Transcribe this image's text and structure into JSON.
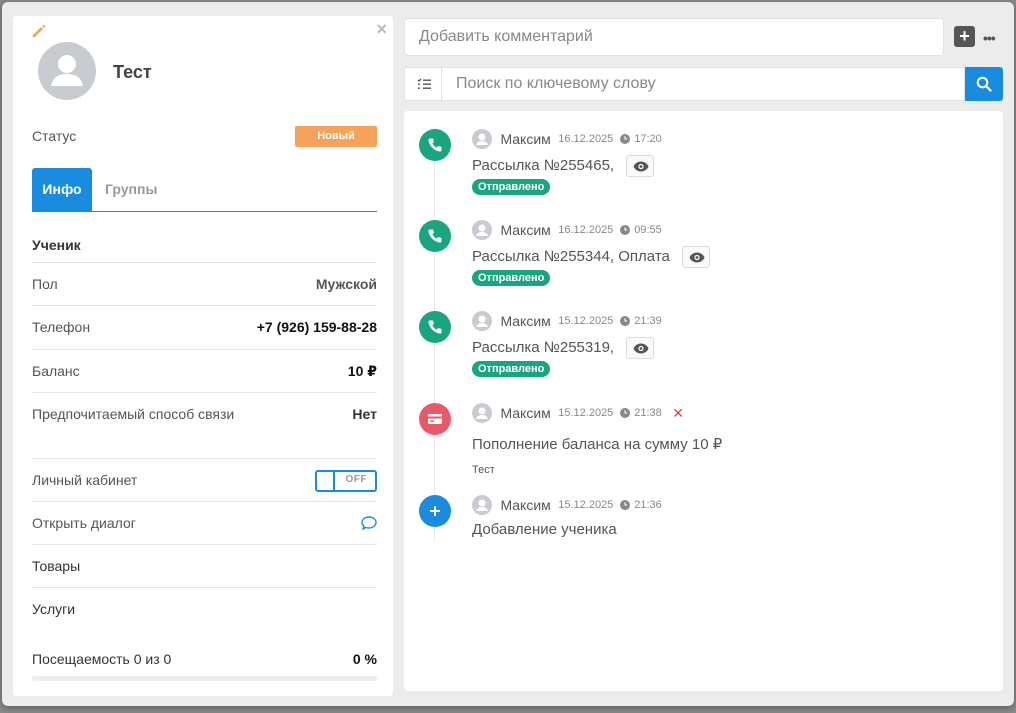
{
  "contact": {
    "name": "Тест",
    "status_label": "Статус",
    "status_value": "Новый"
  },
  "tabs": [
    {
      "label": "Инфо"
    },
    {
      "label": "Группы"
    }
  ],
  "info": {
    "section_title": "Ученик",
    "fields": [
      {
        "label": "Пол",
        "value": "Мужской"
      },
      {
        "label": "Телефон",
        "value": "+7 (926) 159-88-28"
      },
      {
        "label": "Баланс",
        "value": "10 ₽"
      },
      {
        "label": "Предпочитаемый способ связи",
        "value": "Нет"
      }
    ],
    "cabinet_label": "Личный кабинет",
    "cabinet_toggle": "OFF",
    "dialog_label": "Открыть диалог",
    "goods_label": "Товары",
    "services_label": "Услуги",
    "attendance_label": "Посещаемость 0 из 0",
    "attendance_value": "0 %",
    "attendance_fraction": 0
  },
  "comment": {
    "placeholder": "Добавить комментарий"
  },
  "search": {
    "placeholder": "Поиск по ключевому слову"
  },
  "feed": [
    {
      "icon": "phone-icon",
      "color": "#18a57f",
      "author": "Максим",
      "date": "16.12.2025",
      "time": "17:20",
      "text": "Рассылка №255465,",
      "badge": "Отправлено"
    },
    {
      "icon": "phone-icon",
      "color": "#18a57f",
      "author": "Максим",
      "date": "16.12.2025",
      "time": "09:55",
      "text": "Рассылка №255344, Оплата",
      "badge": "Отправлено"
    },
    {
      "icon": "phone-icon",
      "color": "#18a57f",
      "author": "Максим",
      "date": "15.12.2025",
      "time": "21:39",
      "text": "Рассылка №255319,",
      "badge": "Отправлено"
    },
    {
      "icon": "card-icon",
      "color": "#e85a68",
      "author": "Максим",
      "date": "15.12.2025",
      "time": "21:38",
      "text": "Пополнение баланса на сумму 10 ₽",
      "note": "Тест"
    },
    {
      "icon": "plus-icon",
      "color": "#1a8ce0",
      "author": "Максим",
      "date": "15.12.2025",
      "time": "21:36",
      "text": "Добавление ученика"
    }
  ],
  "colors": {
    "accent": "#1a8ce0",
    "success": "#18a57f",
    "warning": "#f5a25a",
    "danger": "#e85a68"
  }
}
